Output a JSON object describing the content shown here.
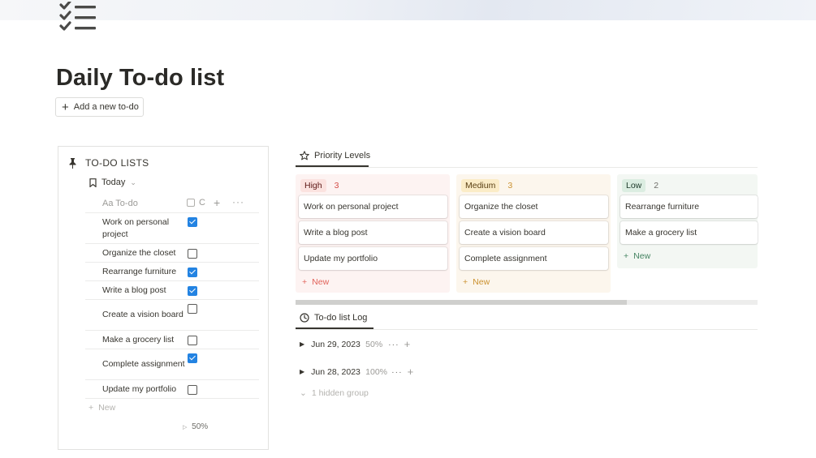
{
  "page": {
    "title": "Daily To-do list",
    "icon": "checklist-icon"
  },
  "add_button": {
    "label": "Add a new to-do",
    "icon": "plus-icon"
  },
  "todo_panel": {
    "heading": "TO-DO LISTS",
    "view_label": "Today",
    "columns": {
      "name": "Aa To-do",
      "checkbox_label": "C"
    },
    "items": [
      {
        "label": "Work on personal project",
        "done": true
      },
      {
        "label": "Organize the closet",
        "done": false
      },
      {
        "label": "Rearrange furniture",
        "done": true
      },
      {
        "label": "Write a blog post",
        "done": true
      },
      {
        "label": "Create a vision board",
        "done": false
      },
      {
        "label": "Make a grocery list",
        "done": false
      },
      {
        "label": "Complete assignment",
        "done": true
      },
      {
        "label": "Update my portfolio",
        "done": false
      }
    ],
    "new_label": "New",
    "calc_value": "50%"
  },
  "board": {
    "tab_label": "Priority Levels",
    "groups": [
      {
        "name": "High",
        "count": "3",
        "bg": "#fdf3f2",
        "pill_bg": "#fbe2df",
        "pill_color": "#5d1715",
        "count_color": "#d44c47",
        "cards": [
          "Work on personal project",
          "Write a blog post",
          "Update my portfolio"
        ],
        "new_label": "New",
        "new_color": "#e16259"
      },
      {
        "name": "Medium",
        "count": "3",
        "bg": "#fcf6ed",
        "pill_bg": "#fbecc7",
        "pill_color": "#5a3f12",
        "count_color": "#cb912f",
        "cards": [
          "Organize the closet",
          "Create a vision board",
          "Complete assignment"
        ],
        "new_label": "New",
        "new_color": "#cb912f"
      },
      {
        "name": "Low",
        "count": "2",
        "bg": "#f3f7f3",
        "pill_bg": "#dbede1",
        "pill_color": "#1c3829",
        "count_color": "#6f6e69",
        "cards": [
          "Rearrange furniture",
          "Make a grocery list"
        ],
        "new_label": "New",
        "new_color": "#448361"
      }
    ]
  },
  "log": {
    "tab_label": "To-do list Log",
    "rows": [
      {
        "date": "Jun 29, 2023",
        "percent": "50%"
      },
      {
        "date": "Jun 28, 2023",
        "percent": "100%"
      }
    ],
    "hidden_group_label": "1 hidden group"
  }
}
